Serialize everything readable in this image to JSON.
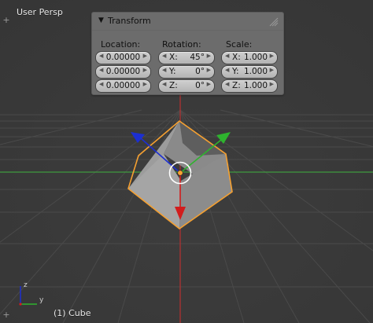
{
  "viewport": {
    "view_name": "User Persp",
    "object_label": "(1) Cube",
    "axis_labels": {
      "x": "y",
      "z": "z"
    }
  },
  "transform_panel": {
    "title": "Transform",
    "location": {
      "label": "Location:",
      "x": "0.00000",
      "y": "0.00000",
      "z": "0.00000"
    },
    "rotation": {
      "label": "Rotation:",
      "x_axis": "X:",
      "x": "45°",
      "y_axis": "Y:",
      "y": "0°",
      "z_axis": "Z:",
      "z": "0°"
    },
    "scale": {
      "label": "Scale:",
      "x_axis": "X:",
      "x": "1.000",
      "y_axis": "Y:",
      "y": "1.000",
      "z_axis": "Z:",
      "z": "1.000"
    }
  },
  "colors": {
    "x_axis": "#d21c1c",
    "y_axis": "#2eb32e",
    "z_axis": "#1c2fd2",
    "selection": "#f5a031",
    "background": "#3a3a3a"
  },
  "icons": [
    "plus-icon",
    "panel-collapse-triangle-icon",
    "panel-grip-icon",
    "axis-gizmo-icon"
  ]
}
